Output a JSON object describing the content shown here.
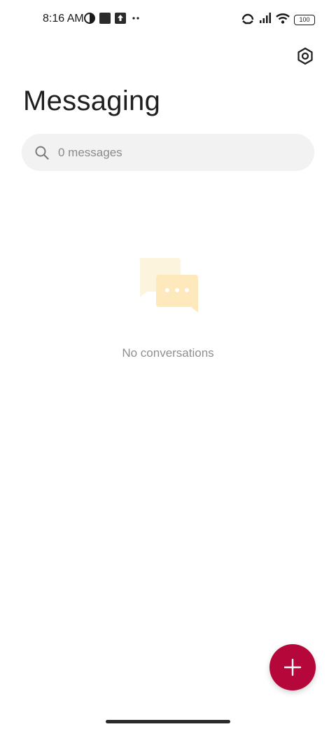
{
  "status_bar": {
    "time": "8:16 AM",
    "battery": "100",
    "left_icons": [
      "data-saver-icon",
      "notification-square-icon",
      "upload-icon",
      "more-dots-icon"
    ],
    "right_icons": [
      "hotspot-icon",
      "cellular-signal-icon",
      "wifi-icon",
      "battery-icon"
    ]
  },
  "header": {
    "title": "Messaging",
    "settings_icon": "settings-hexagon-icon"
  },
  "search": {
    "placeholder": "0 messages",
    "icon": "search-icon"
  },
  "empty_state": {
    "icon": "chat-bubbles-icon",
    "text": "No conversations"
  },
  "fab": {
    "icon": "plus-icon",
    "color": "#b5073a"
  },
  "colors": {
    "accent": "#b5073a",
    "illustration_light": "#fdf3dc",
    "illustration_dark": "#fde8b8"
  }
}
